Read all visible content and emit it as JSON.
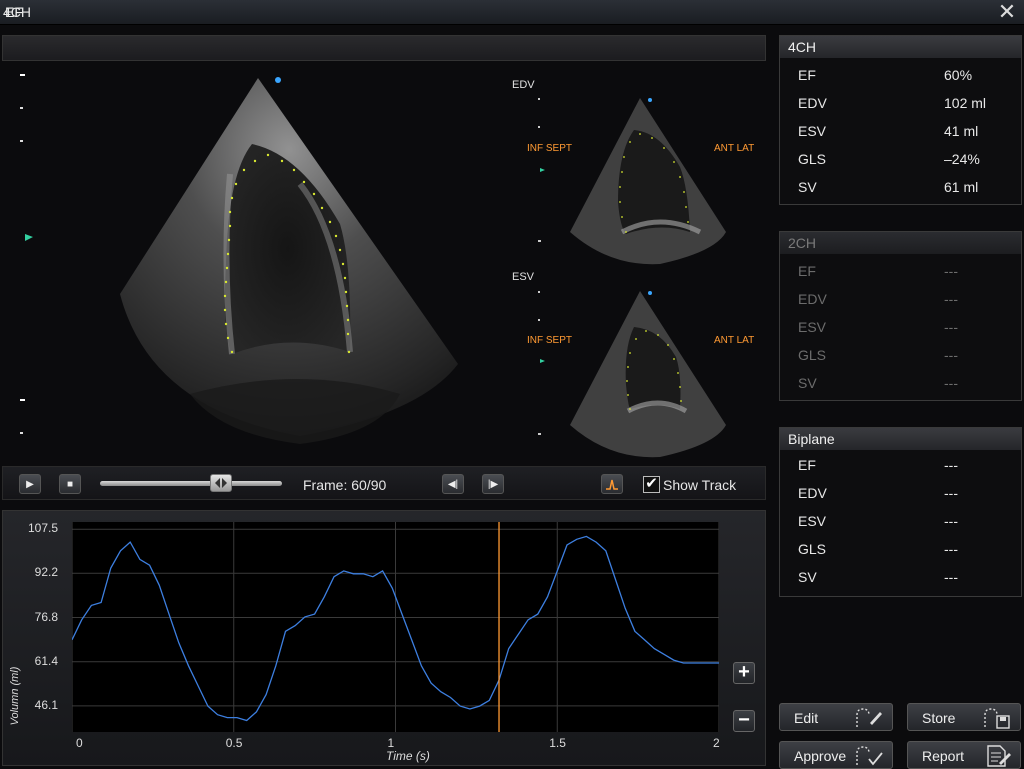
{
  "window": {
    "title": "EF"
  },
  "view": {
    "title": "4CH",
    "edv_label": "EDV",
    "esv_label": "ESV",
    "orient_left": "INF SEPT",
    "orient_right": "ANT LAT"
  },
  "transport": {
    "frame_text": "Frame: 60/90",
    "frame_current": 60,
    "frame_total": 90,
    "show_track_label": "Show Track",
    "show_track_checked": true
  },
  "panels": {
    "ch4": {
      "title": "4CH",
      "rows": [
        {
          "label": "EF",
          "value": "60%"
        },
        {
          "label": "EDV",
          "value": "102 ml"
        },
        {
          "label": "ESV",
          "value": "41 ml"
        },
        {
          "label": "GLS",
          "value": "–24%"
        },
        {
          "label": "SV",
          "value": "61 ml"
        }
      ]
    },
    "ch2": {
      "title": "2CH",
      "rows": [
        {
          "label": "EF",
          "value": "---"
        },
        {
          "label": "EDV",
          "value": "---"
        },
        {
          "label": "ESV",
          "value": "---"
        },
        {
          "label": "GLS",
          "value": "---"
        },
        {
          "label": "SV",
          "value": "---"
        }
      ]
    },
    "biplane": {
      "title": "Biplane",
      "rows": [
        {
          "label": "EF",
          "value": "---"
        },
        {
          "label": "EDV",
          "value": "---"
        },
        {
          "label": "ESV",
          "value": "---"
        },
        {
          "label": "GLS",
          "value": "---"
        },
        {
          "label": "SV",
          "value": "---"
        }
      ]
    }
  },
  "buttons": {
    "edit": "Edit",
    "store": "Store",
    "approve": "Approve",
    "report": "Report",
    "zoom_in": "+",
    "zoom_out": "−"
  },
  "chart_data": {
    "type": "line",
    "title": "",
    "xlabel": "Time (s)",
    "ylabel": "Volumn (ml)",
    "xlim": [
      0,
      2
    ],
    "ylim": [
      37,
      110
    ],
    "x_ticks": [
      "0",
      "0.5",
      "1",
      "1.5",
      "2"
    ],
    "y_ticks": [
      "107.5",
      "92.2",
      "76.8",
      "61.4",
      "46.1"
    ],
    "cursor_x": 1.32,
    "grid": true,
    "series": [
      {
        "color": "#3d7fe0",
        "x": [
          0,
          0.03,
          0.06,
          0.09,
          0.12,
          0.15,
          0.18,
          0.21,
          0.24,
          0.27,
          0.3,
          0.33,
          0.36,
          0.39,
          0.42,
          0.45,
          0.48,
          0.51,
          0.54,
          0.57,
          0.6,
          0.63,
          0.66,
          0.69,
          0.72,
          0.75,
          0.78,
          0.81,
          0.84,
          0.87,
          0.9,
          0.93,
          0.96,
          0.99,
          1.02,
          1.05,
          1.08,
          1.11,
          1.14,
          1.17,
          1.2,
          1.23,
          1.26,
          1.29,
          1.32,
          1.35,
          1.38,
          1.41,
          1.44,
          1.47,
          1.5,
          1.53,
          1.56,
          1.59,
          1.62,
          1.65,
          1.68,
          1.71,
          1.74,
          1.77,
          1.8,
          1.83,
          1.86,
          1.89,
          1.92,
          1.95,
          1.98,
          2.0
        ],
        "y": [
          69,
          76,
          81,
          82,
          94,
          100,
          103,
          97,
          95,
          88,
          78,
          68,
          60,
          53,
          46,
          43,
          42,
          42,
          41,
          44,
          50,
          60,
          72,
          74,
          77,
          78,
          84,
          91,
          93,
          92,
          92,
          91,
          93,
          87,
          78,
          69,
          60,
          54,
          51,
          49,
          46,
          45,
          46,
          48,
          55,
          66,
          71,
          76,
          78,
          84,
          93,
          102,
          104,
          105,
          103,
          100,
          90,
          80,
          72,
          69,
          66,
          64,
          62,
          61,
          61,
          61,
          61,
          61
        ]
      }
    ]
  }
}
